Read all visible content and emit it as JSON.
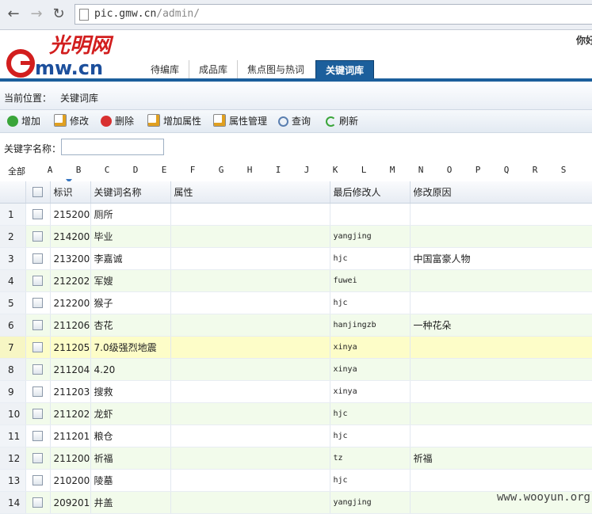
{
  "browser": {
    "back_glyph": "←",
    "forward_glyph": "→",
    "reload_glyph": "↻",
    "url_host": "pic.gmw.cn",
    "url_path": "/admin/"
  },
  "header": {
    "greeting": "你好",
    "logo_text": "Gmw.cn",
    "logo_cn": "光明网",
    "tabs": [
      {
        "label": "待编库",
        "active": false
      },
      {
        "label": "成品库",
        "active": false
      },
      {
        "label": "焦点图与热词",
        "active": false
      },
      {
        "label": "关键词库",
        "active": true
      }
    ]
  },
  "breadcrumb": {
    "label": "当前位置：",
    "current": "关键词库"
  },
  "toolbar": [
    {
      "label": "增加",
      "icon": "add-icon",
      "color": "#3aa53a"
    },
    {
      "label": "修改",
      "icon": "edit-icon",
      "color": "#e0a020"
    },
    {
      "label": "删除",
      "icon": "delete-icon",
      "color": "#d83030"
    },
    {
      "label": "增加属性",
      "icon": "edit-icon",
      "color": "#e0a020"
    },
    {
      "label": "属性管理",
      "icon": "edit-icon",
      "color": "#e0a020"
    },
    {
      "label": "查询",
      "icon": "search-icon",
      "color": "#5a7fb0"
    },
    {
      "label": "刷新",
      "icon": "refresh-icon",
      "color": "#3aa53a"
    }
  ],
  "search": {
    "label": "关键字名称：",
    "value": ""
  },
  "letters": [
    "全部",
    "A",
    "B",
    "C",
    "D",
    "E",
    "F",
    "G",
    "H",
    "I",
    "J",
    "K",
    "L",
    "M",
    "N",
    "O",
    "P",
    "Q",
    "R",
    "S"
  ],
  "table": {
    "columns": [
      "",
      "",
      "标识",
      "关键词名称",
      "属性",
      "最后修改人",
      "修改原因"
    ],
    "rows": [
      {
        "n": "1",
        "id": "215200",
        "name": "厕所",
        "attr": "",
        "user": "",
        "reason": ""
      },
      {
        "n": "2",
        "id": "214200",
        "name": "毕业",
        "attr": "",
        "user": "yangjing",
        "reason": ""
      },
      {
        "n": "3",
        "id": "213200",
        "name": "李嘉诚",
        "attr": "",
        "user": "hjc",
        "reason": "中国富豪人物"
      },
      {
        "n": "4",
        "id": "212202",
        "name": "军嫂",
        "attr": "",
        "user": "fuwei",
        "reason": ""
      },
      {
        "n": "5",
        "id": "212200",
        "name": "猴子",
        "attr": "",
        "user": "hjc",
        "reason": ""
      },
      {
        "n": "6",
        "id": "211206",
        "name": "杏花",
        "attr": "",
        "user": "hanjingzb",
        "reason": "一种花朵"
      },
      {
        "n": "7",
        "id": "211205",
        "name": "7.0级强烈地震",
        "attr": "",
        "user": "xinya",
        "reason": ""
      },
      {
        "n": "8",
        "id": "211204",
        "name": "4.20",
        "attr": "",
        "user": "xinya",
        "reason": ""
      },
      {
        "n": "9",
        "id": "211203",
        "name": "搜救",
        "attr": "",
        "user": "xinya",
        "reason": ""
      },
      {
        "n": "10",
        "id": "211202",
        "name": "龙虾",
        "attr": "",
        "user": "hjc",
        "reason": ""
      },
      {
        "n": "11",
        "id": "211201",
        "name": "粮仓",
        "attr": "",
        "user": "hjc",
        "reason": ""
      },
      {
        "n": "12",
        "id": "211200",
        "name": "祈福",
        "attr": "",
        "user": "tz",
        "reason": "祈福"
      },
      {
        "n": "13",
        "id": "210200",
        "name": "陵墓",
        "attr": "",
        "user": "hjc",
        "reason": ""
      },
      {
        "n": "14",
        "id": "209201",
        "name": "井盖",
        "attr": "",
        "user": "yangjing",
        "reason": ""
      }
    ],
    "selected_row": 7
  },
  "watermark": "www.wooyun.org"
}
